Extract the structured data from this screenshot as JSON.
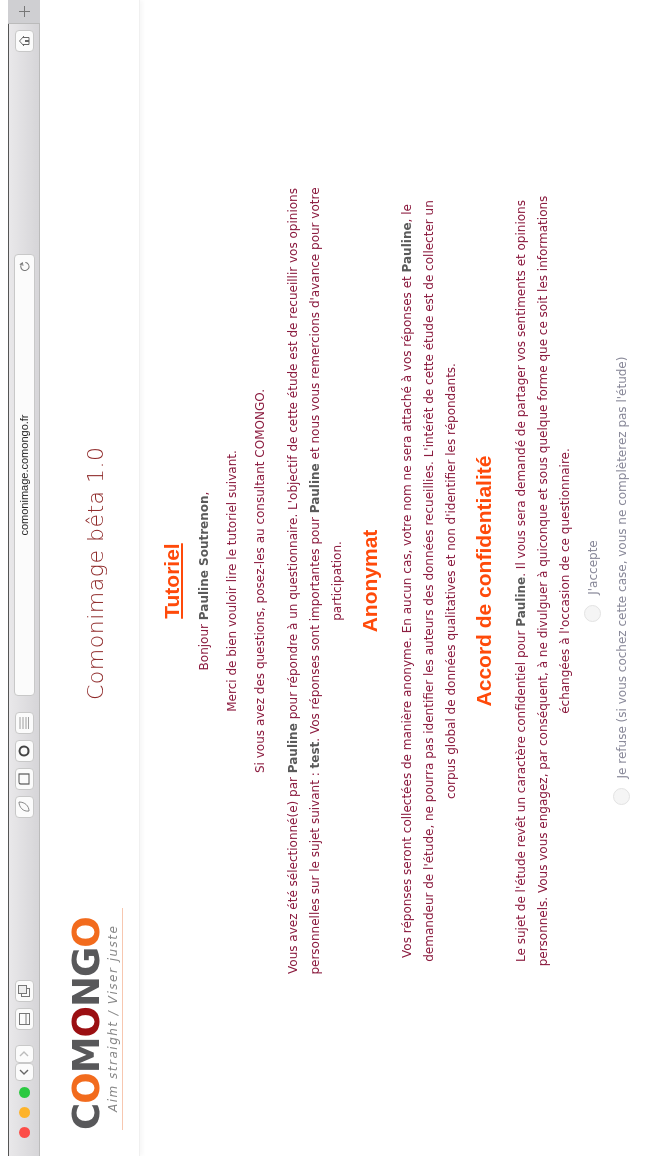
{
  "browser": {
    "address": "comonimage.comongo.fr"
  },
  "header": {
    "logo_letters": [
      {
        "char": "C",
        "color": "#58585a"
      },
      {
        "char": "O",
        "color": "#f26b1d"
      },
      {
        "char": "M",
        "color": "#58585a"
      },
      {
        "char": "O",
        "color": "#9b0f12"
      },
      {
        "char": "N",
        "color": "#58585a"
      },
      {
        "char": "G",
        "color": "#58585a"
      },
      {
        "char": "O",
        "color": "#f26b1d"
      }
    ],
    "tagline": "Aim straight / Viser juste",
    "title": "Comonimage bêta 1.0"
  },
  "content": [
    {
      "kind": "heading",
      "text": "Tutoriel",
      "underlined": true
    },
    {
      "kind": "line",
      "text": "Bonjour **Pauline Soutrenon**,"
    },
    {
      "kind": "line",
      "text": "Merci de bien vouloir lire le tutoriel suivant."
    },
    {
      "kind": "line",
      "text": "Si vous avez des questions, posez-les au consultant COMONGO."
    },
    {
      "kind": "paragraph",
      "text": "Vous avez été sélectionné(e) par **Pauline** pour répondre à un questionnaire. L'objectif de cette étude est de recueillir vos opinions personnelles sur le sujet suivant : **test**. Vos réponses sont importantes pour **Pauline** et nous vous remercions d'avance pour votre participation."
    },
    {
      "kind": "heading",
      "text": "Anonymat",
      "underlined": false
    },
    {
      "kind": "paragraph",
      "text": "Vos réponses seront collectées de manière anonyme. En aucun cas, votre nom ne sera attaché à vos réponses et **Pauline**, le demandeur de l'étude, ne pourra pas identifier les auteurs des données recueillies. L'intérêt de cette étude est de collecter un corpus global de données qualitatives et non d'identifier les répondants."
    },
    {
      "kind": "heading",
      "text": "Accord de confidentialité",
      "underlined": false
    },
    {
      "kind": "paragraph",
      "text": "Le sujet de l'étude revêt un caractère confidentiel pour **Pauline**. Il vous sera demandé de partager vos sentiments et opinions personnels. Vous vous engagez, par conséquent, à ne divulguer à quiconque et sous quelque forme que ce soit les informations échangées à l'occasion de ce questionnaire."
    },
    {
      "kind": "radio",
      "text": "J'accepte",
      "selected": false
    },
    {
      "kind": "radio",
      "text": "Je refuse (si vous cochez cette case, vous ne complèterez pas l'étude)",
      "selected": false
    }
  ]
}
